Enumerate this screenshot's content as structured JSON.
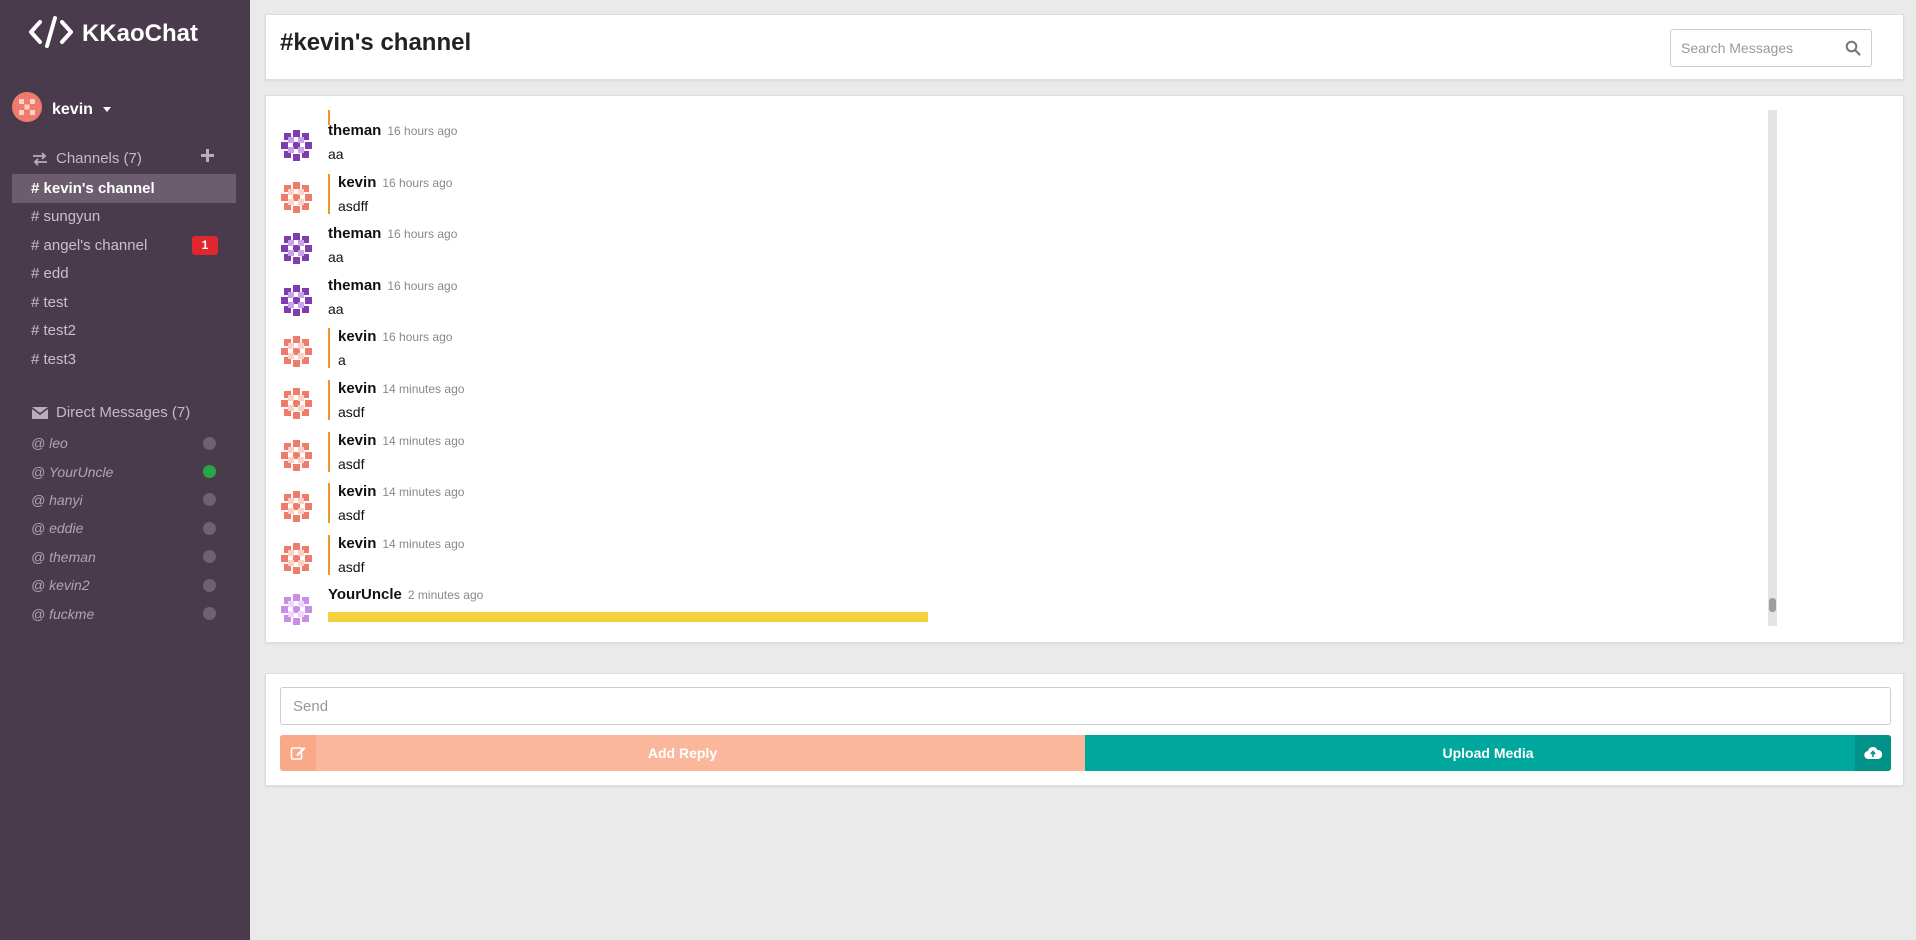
{
  "app": {
    "name": "KKaoChat"
  },
  "user": {
    "name": "kevin"
  },
  "sidebar": {
    "channels_header": "Channels (7)",
    "channels": [
      {
        "label": "# kevin's channel",
        "active": true
      },
      {
        "label": "# sungyun"
      },
      {
        "label": "# angel's channel",
        "badge": "1"
      },
      {
        "label": "# edd"
      },
      {
        "label": "# test"
      },
      {
        "label": "# test2"
      },
      {
        "label": "# test3"
      }
    ],
    "dm_header": "Direct Messages (7)",
    "dms": [
      {
        "label": "@ leo",
        "status": "offline"
      },
      {
        "label": "@ YourUncle",
        "status": "online"
      },
      {
        "label": "@ hanyi",
        "status": "offline"
      },
      {
        "label": "@ eddie",
        "status": "offline"
      },
      {
        "label": "@ theman",
        "status": "offline"
      },
      {
        "label": "@ kevin2",
        "status": "offline"
      },
      {
        "label": "@ fuckme",
        "status": "offline"
      }
    ]
  },
  "header": {
    "channel_title": "#kevin's channel",
    "search_placeholder": "Search Messages"
  },
  "messages": [
    {
      "author": "theman",
      "time": "16 hours ago",
      "text": "aa",
      "own": false,
      "avatar": "purple"
    },
    {
      "author": "kevin",
      "time": "16 hours ago",
      "text": "asdff",
      "own": true,
      "avatar": "red"
    },
    {
      "author": "theman",
      "time": "16 hours ago",
      "text": "aa",
      "own": false,
      "avatar": "purple"
    },
    {
      "author": "theman",
      "time": "16 hours ago",
      "text": "aa",
      "own": false,
      "avatar": "purple"
    },
    {
      "author": "kevin",
      "time": "16 hours ago",
      "text": "a",
      "own": true,
      "avatar": "red"
    },
    {
      "author": "kevin",
      "time": "14 minutes ago",
      "text": "asdf",
      "own": true,
      "avatar": "red"
    },
    {
      "author": "kevin",
      "time": "14 minutes ago",
      "text": "asdf",
      "own": true,
      "avatar": "red"
    },
    {
      "author": "kevin",
      "time": "14 minutes ago",
      "text": "asdf",
      "own": true,
      "avatar": "red"
    },
    {
      "author": "kevin",
      "time": "14 minutes ago",
      "text": "asdf",
      "own": true,
      "avatar": "red"
    },
    {
      "author": "YourUncle",
      "time": "2 minutes ago",
      "text": "",
      "own": false,
      "avatar": "violet"
    }
  ],
  "compose": {
    "send_placeholder": "Send",
    "add_reply_label": "Add Reply",
    "upload_label": "Upload Media"
  },
  "colors": {
    "sidebar_bg": "#4a3b4c",
    "accent_orange": "#f0952c",
    "reply_btn": "#fbb79b",
    "upload_btn": "#00a79d",
    "badge_red": "#e0262f",
    "online_green": "#26a647"
  },
  "icons": [
    "code-logo-icon",
    "exchange-icon",
    "plus-icon",
    "envelope-icon",
    "search-icon",
    "edit-icon",
    "cloud-upload-icon",
    "caret-down-icon"
  ]
}
